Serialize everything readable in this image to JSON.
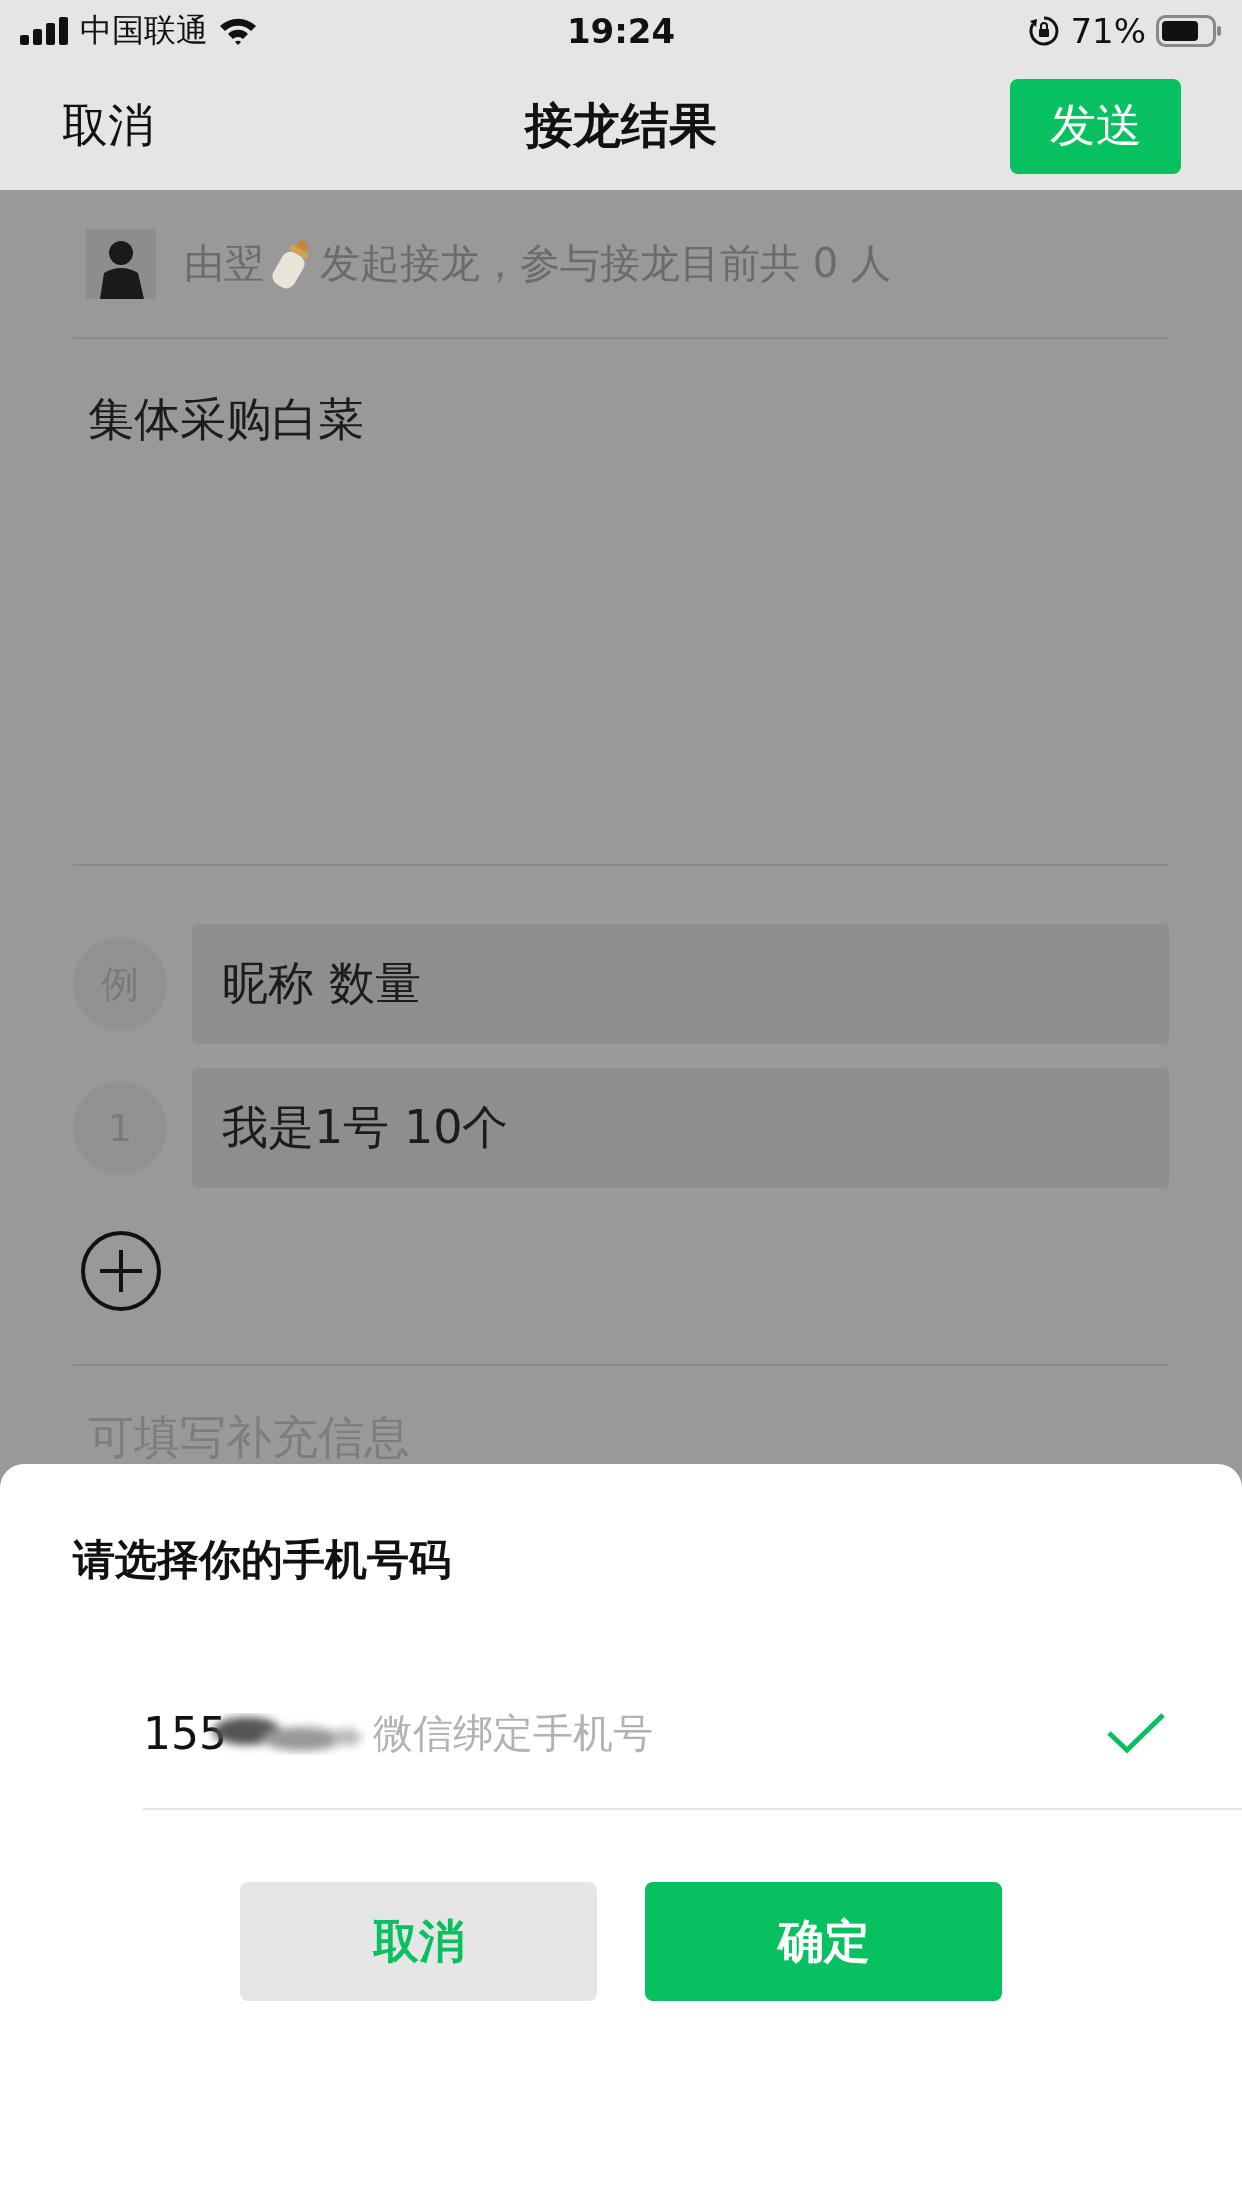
{
  "status_bar": {
    "carrier": "中国联通",
    "time": "19:24",
    "battery": "71%"
  },
  "nav": {
    "cancel": "取消",
    "title": "接龙结果",
    "send": "发送"
  },
  "creator": {
    "name": "由翌",
    "text": "发起接龙，参与接龙目前共 0 人"
  },
  "topic": "集体采购白菜",
  "entries": [
    {
      "marker": "例",
      "text": "昵称 数量"
    },
    {
      "marker": "1",
      "text": "我是1号 10个"
    }
  ],
  "supplement": {
    "placeholder": "可填写补充信息"
  },
  "sheet": {
    "title": "请选择你的手机号码",
    "options": [
      {
        "number": "155",
        "label": "微信绑定手机号",
        "selected": true
      }
    ],
    "buttons": [
      {
        "label": "取消",
        "kind": "secondary"
      },
      {
        "label": "确定",
        "kind": "primary"
      }
    ]
  }
}
